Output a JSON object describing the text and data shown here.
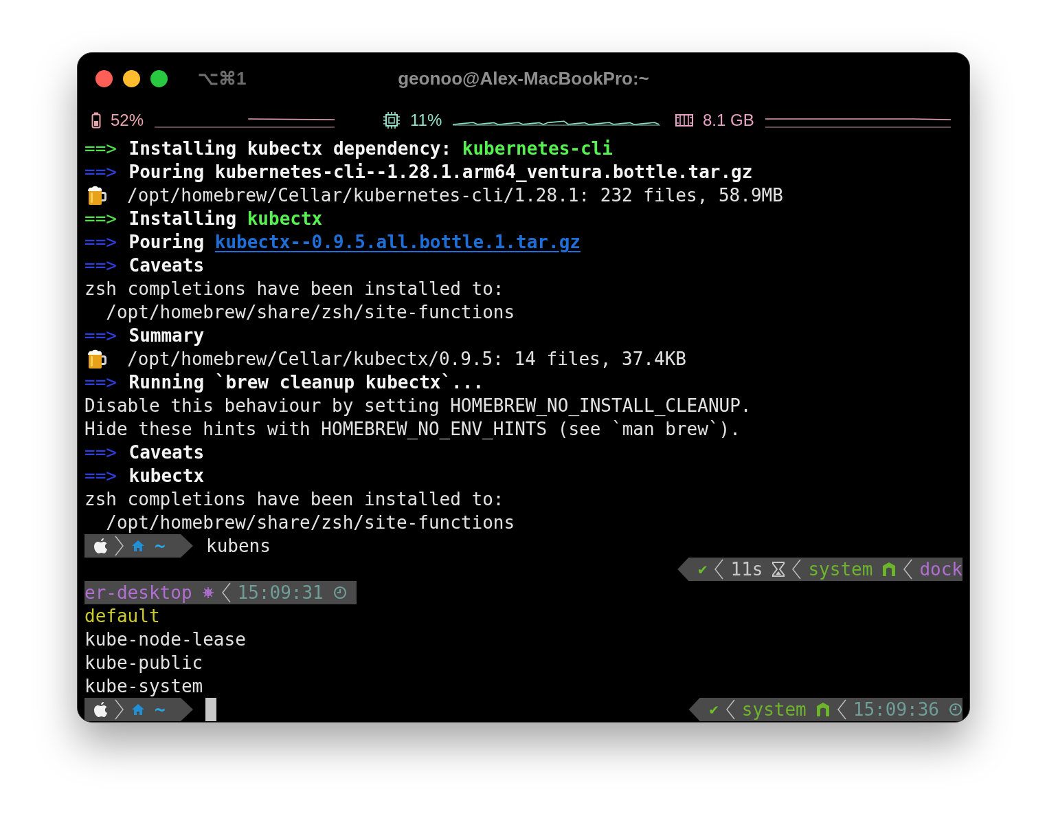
{
  "window": {
    "shortcut": "⌥⌘1",
    "title": "geonoo@Alex-MacBookPro:~"
  },
  "status_bar": [
    {
      "kind": "battery",
      "reading": "52%"
    },
    {
      "kind": "cpu",
      "reading": "11%"
    },
    {
      "kind": "memory",
      "reading": "8.1 GB"
    }
  ],
  "lines": [
    {
      "kind": "install",
      "marker": "==>",
      "segments": [
        {
          "text": "Installing kubectx dependency: ",
          "kind": "title"
        },
        {
          "text": "kubernetes-cli",
          "kind": "package"
        }
      ]
    },
    {
      "kind": "step",
      "marker": "==>",
      "segments": [
        {
          "text": "Pouring kubernetes-cli--1.28.1.arm64_ventura.bottle.tar.gz",
          "kind": "title"
        }
      ]
    },
    {
      "kind": "beer",
      "text": "/opt/homebrew/Cellar/kubernetes-cli/1.28.1: 232 files, 58.9MB"
    },
    {
      "kind": "install",
      "marker": "==>",
      "segments": [
        {
          "text": "Installing ",
          "kind": "title"
        },
        {
          "text": "kubectx",
          "kind": "package"
        }
      ]
    },
    {
      "kind": "step",
      "marker": "==>",
      "segments": [
        {
          "text": "Pouring ",
          "kind": "title"
        },
        {
          "text": "kubectx--0.9.5.all.bottle.1.tar.gz",
          "kind": "link"
        }
      ]
    },
    {
      "kind": "step",
      "marker": "==>",
      "segments": [
        {
          "text": "Caveats",
          "kind": "title"
        }
      ]
    },
    {
      "kind": "plain",
      "text": "zsh completions have been installed to:"
    },
    {
      "kind": "plain",
      "text": "  /opt/homebrew/share/zsh/site-functions"
    },
    {
      "kind": "step",
      "marker": "==>",
      "segments": [
        {
          "text": "Summary",
          "kind": "title"
        }
      ]
    },
    {
      "kind": "beer",
      "text": "/opt/homebrew/Cellar/kubectx/0.9.5: 14 files, 37.4KB"
    },
    {
      "kind": "step",
      "marker": "==>",
      "segments": [
        {
          "text": "Running `brew cleanup kubectx`...",
          "kind": "title"
        }
      ]
    },
    {
      "kind": "plain",
      "text": "Disable this behaviour by setting HOMEBREW_NO_INSTALL_CLEANUP."
    },
    {
      "kind": "plain",
      "text": "Hide these hints with HOMEBREW_NO_ENV_HINTS (see `man brew`)."
    },
    {
      "kind": "step",
      "marker": "==>",
      "segments": [
        {
          "text": "Caveats",
          "kind": "title"
        }
      ]
    },
    {
      "kind": "step",
      "marker": "==>",
      "segments": [
        {
          "text": "kubectx",
          "kind": "title"
        }
      ]
    },
    {
      "kind": "plain",
      "text": "zsh completions have been installed to:"
    },
    {
      "kind": "plain",
      "text": "  /opt/homebrew/share/zsh/site-functions"
    },
    {
      "kind": "prompt",
      "dir": "~",
      "command": "kubens"
    },
    {
      "kind": "right_prompt",
      "segments": [
        {
          "kind": "status",
          "text": "✔"
        },
        {
          "kind": "duration",
          "text": "11s"
        },
        {
          "kind": "env",
          "text": "system"
        },
        {
          "kind": "context",
          "text": "dock"
        }
      ]
    },
    {
      "kind": "continuation",
      "segments": [
        {
          "kind": "context",
          "text": "er-desktop"
        },
        {
          "kind": "time",
          "text": "15:09:31"
        }
      ]
    },
    {
      "kind": "current",
      "text": "default"
    },
    {
      "kind": "plain",
      "text": "kube-node-lease"
    },
    {
      "kind": "plain",
      "text": "kube-public"
    },
    {
      "kind": "plain",
      "text": "kube-system"
    },
    {
      "kind": "prompt",
      "dir": "~",
      "cursor": true,
      "right": [
        {
          "kind": "status",
          "text": "✔"
        },
        {
          "kind": "env",
          "text": "system"
        },
        {
          "kind": "time",
          "text": "15:09:36"
        }
      ]
    }
  ]
}
